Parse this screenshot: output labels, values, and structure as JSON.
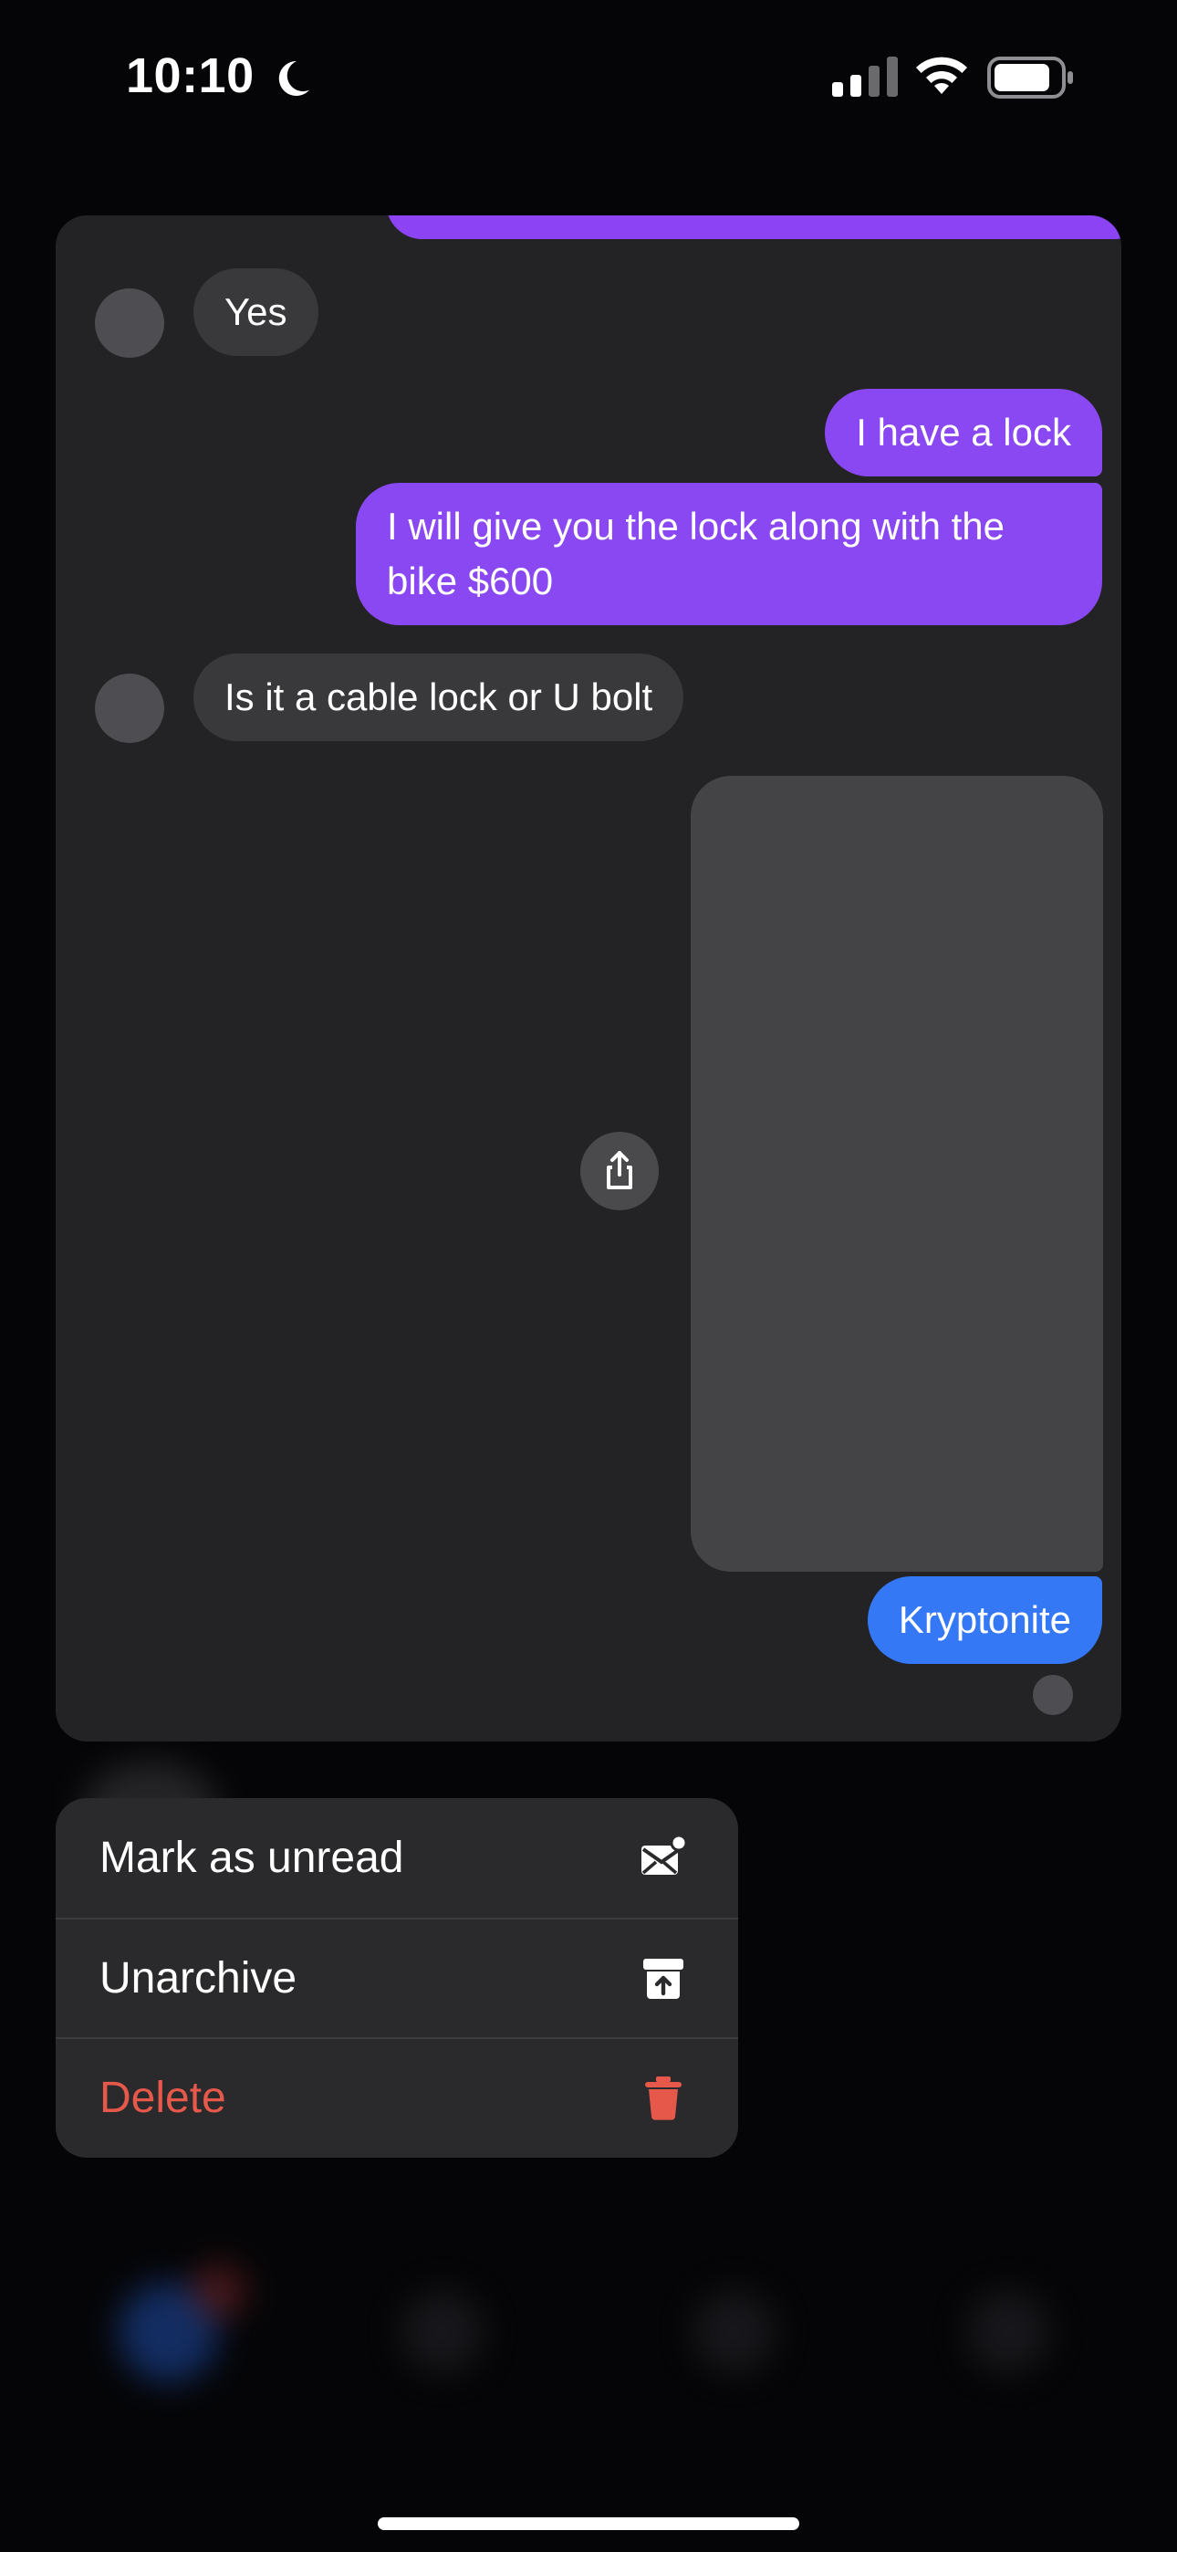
{
  "status_bar": {
    "time": "10:10",
    "icons": [
      "moon-icon",
      "signal-icon",
      "wifi-icon",
      "battery-icon"
    ]
  },
  "chat": {
    "messages": [
      {
        "side": "incoming",
        "text": "Yes"
      },
      {
        "side": "outgoing",
        "text": "I have a lock"
      },
      {
        "side": "outgoing",
        "text": "I will give you the lock along with the bike $600"
      },
      {
        "side": "incoming",
        "text": "Is it a cable lock or U bolt"
      },
      {
        "side": "outgoing",
        "type": "media",
        "text": ""
      },
      {
        "side": "outgoing",
        "text": "Kryptonite"
      }
    ],
    "share_icon": "share-icon"
  },
  "menu": {
    "items": [
      {
        "label": "Mark as unread",
        "icon": "mark-unread-icon"
      },
      {
        "label": "Unarchive",
        "icon": "unarchive-icon"
      },
      {
        "label": "Delete",
        "icon": "trash-icon",
        "destructive": true
      }
    ]
  },
  "colors": {
    "outgoing_bubble": "#8a48f2",
    "link_bubble": "#3478f6",
    "incoming_bubble": "#39393c",
    "destructive": "#e5584a"
  }
}
